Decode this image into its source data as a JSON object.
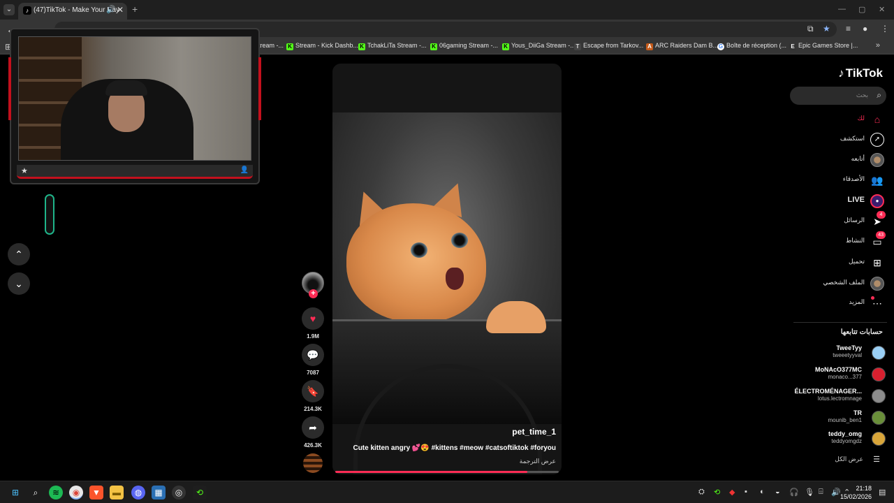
{
  "browser": {
    "tab_title": "(47)TikTok - Make Your Day",
    "tab_favicon": "tiktok-favicon",
    "bookmarks": [
      "Stream -...",
      "Stream - Kick Dashb...",
      "TchakLiTa Stream -...",
      "06gaming Stream -...",
      "Yous_DiiGa Stream -...",
      "Escape from Tarkov...",
      "ARC Raiders Dam B...",
      "Boîte de réception (...",
      "Epic Games Store |..."
    ]
  },
  "video": {
    "author": "pet_time_1",
    "description": "Cute kitten angry 💕😍 #kittens #meow #catsoftiktok #foryou",
    "translate_label": "عرض الترجمة",
    "progress": 0.86
  },
  "actions": {
    "likes": "1.9M",
    "comments": "7087",
    "saves": "214.3K",
    "shares": "426.3K"
  },
  "sidebar": {
    "logo_text": "TikTok",
    "search_placeholder": "بحث",
    "nav": [
      {
        "label": "لك",
        "icon": "home-icon"
      },
      {
        "label": "استكشف",
        "icon": "compass-icon"
      },
      {
        "label": "أتابعه",
        "icon": "following-avatar-icon"
      },
      {
        "label": "الأصدقاء",
        "icon": "friends-icon"
      },
      {
        "label": "LIVE",
        "icon": "live-icon"
      },
      {
        "label": "الرسائل",
        "icon": "messages-icon",
        "badge": "4"
      },
      {
        "label": "النشاط",
        "icon": "activity-icon",
        "badge": "43"
      },
      {
        "label": "تحميل",
        "icon": "upload-icon"
      },
      {
        "label": "الملف الشخصي",
        "icon": "profile-avatar-icon"
      },
      {
        "label": "المزيد",
        "icon": "more-icon"
      }
    ],
    "following_title": "حسابات تتابعها",
    "following": [
      {
        "name": "TweeTyy",
        "handle": "tweeetyyval",
        "color": "#9bd0f5"
      },
      {
        "name": "MoNAcO377MC",
        "handle": "monaco...377",
        "color": "#d8202f"
      },
      {
        "name": "ÉLECTROMÉNAGER...",
        "handle": "lotus.lectromnage",
        "color": "#8c8c8c"
      },
      {
        "name": "TR",
        "handle": "mounib_ben1",
        "color": "#6a8f3a"
      },
      {
        "name": "teddy_omg",
        "handle": "teddyomgdz",
        "color": "#d9a63a"
      }
    ],
    "see_all_label": "عرض الكل"
  },
  "taskbar": {
    "time": "21:18",
    "date": "15/02/2026"
  },
  "colors": {
    "accent": "#fe2c55",
    "stream_frame": "#c3101d"
  }
}
